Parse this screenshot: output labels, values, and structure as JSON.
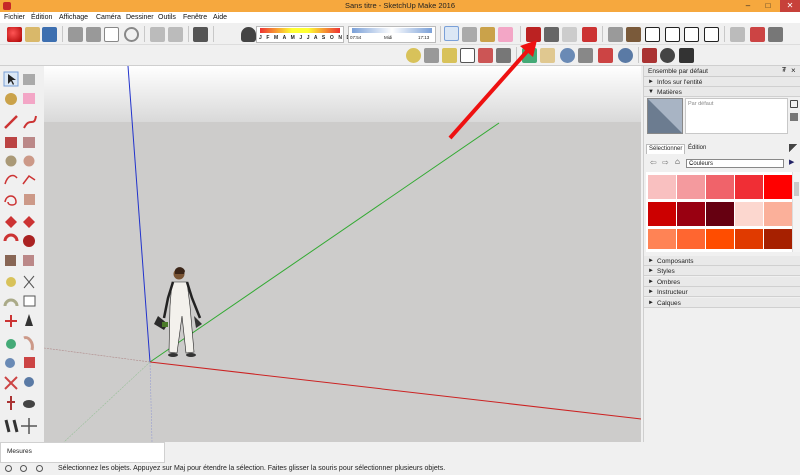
{
  "window": {
    "title": "Sans titre - SketchUp Make 2016",
    "minimize": "–",
    "maximize": "□",
    "close": "✕"
  },
  "menu": [
    "Fichier",
    "Édition",
    "Affichage",
    "Caméra",
    "Dessiner",
    "Outils",
    "Fenêtre",
    "Aide"
  ],
  "shadows": {
    "months": "J F M A M J J A S O N D",
    "time_start": "07:54",
    "time_mid": "Midi",
    "time_end": "17:13"
  },
  "tray": {
    "title": "Ensemble par défaut",
    "pin": "₮",
    "close": "×",
    "sections_top": [
      {
        "label": "Infos sur l'entité",
        "expanded": false
      },
      {
        "label": "Matières",
        "expanded": true
      }
    ],
    "material_name_placeholder": "Par défaut",
    "tabs": [
      "Sélectionner",
      "Édition"
    ],
    "collection": "Couleurs",
    "palette": [
      [
        "#f9c0c0",
        "#f49a9e",
        "#f0636a",
        "#f02e35",
        "#ff0000"
      ],
      [
        "#cc0000",
        "#990011",
        "#660011",
        "#fcd7cf",
        "#fbb09a"
      ],
      [
        "#ff8355",
        "#ff6630",
        "#ff4d00",
        "#e03a00",
        "#a62000"
      ]
    ],
    "sections_bottom": [
      "Composants",
      "Styles",
      "Ombres",
      "Instructeur",
      "Calques"
    ]
  },
  "measures_label": "Mesures",
  "status_text": "Sélectionnez les objets. Appuyez sur Maj pour étendre la sélection. Faites glisser la souris pour sélectionner plusieurs objets.",
  "colors": {
    "titlebar": "#f6a83e",
    "axis_blue": "#2233cc",
    "axis_green": "#33aa33",
    "axis_red": "#cc2222",
    "arrow_red": "#ee1111",
    "ground": "#cdcccb"
  },
  "icons": {
    "toolbar_row1": [
      "new-icon",
      "open-icon",
      "save-icon",
      "cut-icon",
      "copy-icon",
      "erase-icon",
      "undo-icon",
      "redo-icon",
      "print-icon",
      "select-icon",
      "make-component-icon",
      "paint-bucket-icon",
      "eraser-icon",
      "get-models-icon",
      "share-model-icon",
      "extension-warehouse-icon",
      "iso-view-icon",
      "top-view-icon",
      "front-view-icon",
      "right-view-icon",
      "back-view-icon",
      "left-view-icon"
    ],
    "toolbar_row2": [
      "tape-icon",
      "dimension-icon",
      "protractor-icon",
      "text-icon",
      "axes-icon",
      "3d-text-icon",
      "orbit-icon",
      "pan-icon",
      "zoom-icon",
      "zoom-extents-icon",
      "position-camera-icon",
      "look-around-icon",
      "walk-icon"
    ]
  }
}
